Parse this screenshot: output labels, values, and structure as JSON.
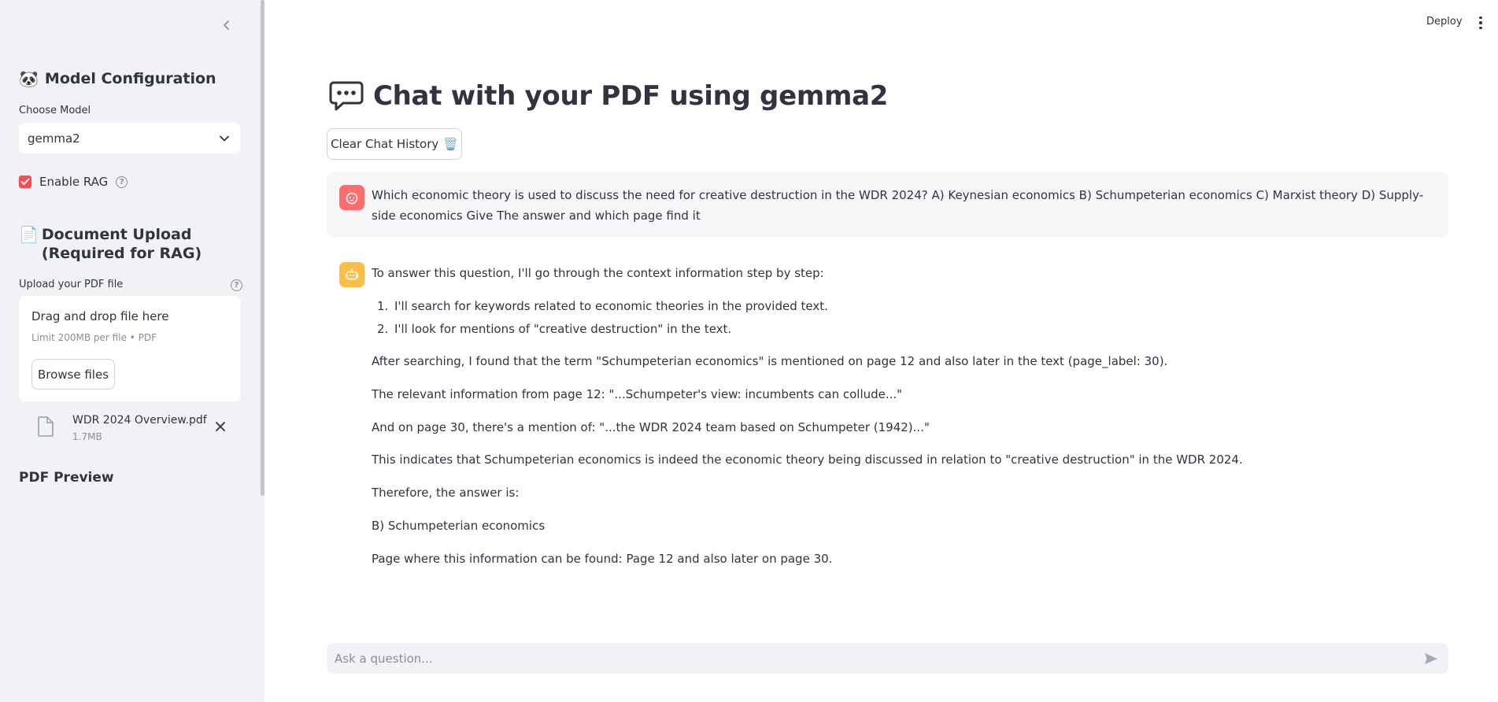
{
  "sidebar": {
    "model_section_title": "Model Configuration",
    "model_section_emoji": "🐼",
    "choose_model_label": "Choose Model",
    "selected_model": "gemma2",
    "enable_rag_label": "Enable RAG",
    "enable_rag_checked": true,
    "upload_section_emoji": "📄",
    "upload_section_title": "Document Upload (Required for RAG)",
    "upload_label": "Upload your PDF file",
    "dropzone_title": "Drag and drop file here",
    "dropzone_limit": "Limit 200MB per file • PDF",
    "browse_label": "Browse files",
    "uploaded_file": {
      "name": "WDR 2024 Overview.pdf",
      "size": "1.7MB"
    },
    "pdf_preview_title": "PDF Preview"
  },
  "header": {
    "deploy_label": "Deploy"
  },
  "main": {
    "title_emoji": "💬",
    "title": "Chat with your PDF using gemma2",
    "clear_label": "Clear Chat History",
    "clear_emoji": "🗑️",
    "user_message": "Which economic theory is used to discuss the need for creative destruction in the WDR 2024? A) Keynesian economics B) Schumpeterian economics C) Marxist theory D) Supply-side economics Give The answer and which page find it",
    "assistant": {
      "intro": "To answer this question, I'll go through the context information step by step:",
      "steps": [
        {
          "num": "1.",
          "text": "I'll search for keywords related to economic theories in the provided text."
        },
        {
          "num": "2.",
          "text": "I'll look for mentions of \"creative destruction\" in the text."
        }
      ],
      "p1": "After searching, I found that the term \"Schumpeterian economics\" is mentioned on page 12 and also later in the text (page_label: 30).",
      "p2": "The relevant information from page 12: \"...Schumpeter's view: incumbents can collude...\"",
      "p3": "And on page 30, there's a mention of: \"...the WDR 2024 team based on Schumpeter (1942)...\"",
      "p4": "This indicates that Schumpeterian economics is indeed the economic theory being discussed in relation to \"creative destruction\" in the WDR 2024.",
      "p5": "Therefore, the answer is:",
      "p6": "B) Schumpeterian economics",
      "p7": "Page where this information can be found: Page 12 and also later on page 30."
    },
    "input_placeholder": "Ask a question..."
  },
  "colors": {
    "accent": "#ff4b4b",
    "user_avatar": "#ff6c6c",
    "bot_avatar": "#ffbd45",
    "sidebar_bg": "#f0f2f6"
  },
  "icons": [
    "chevron-left-icon",
    "panda-emoji-icon",
    "chevron-down-icon",
    "check-icon",
    "help-icon",
    "page-emoji-icon",
    "file-icon",
    "close-icon",
    "speech-balloon-icon",
    "trash-icon",
    "user-face-icon",
    "robot-icon",
    "send-icon",
    "more-vertical-icon"
  ]
}
